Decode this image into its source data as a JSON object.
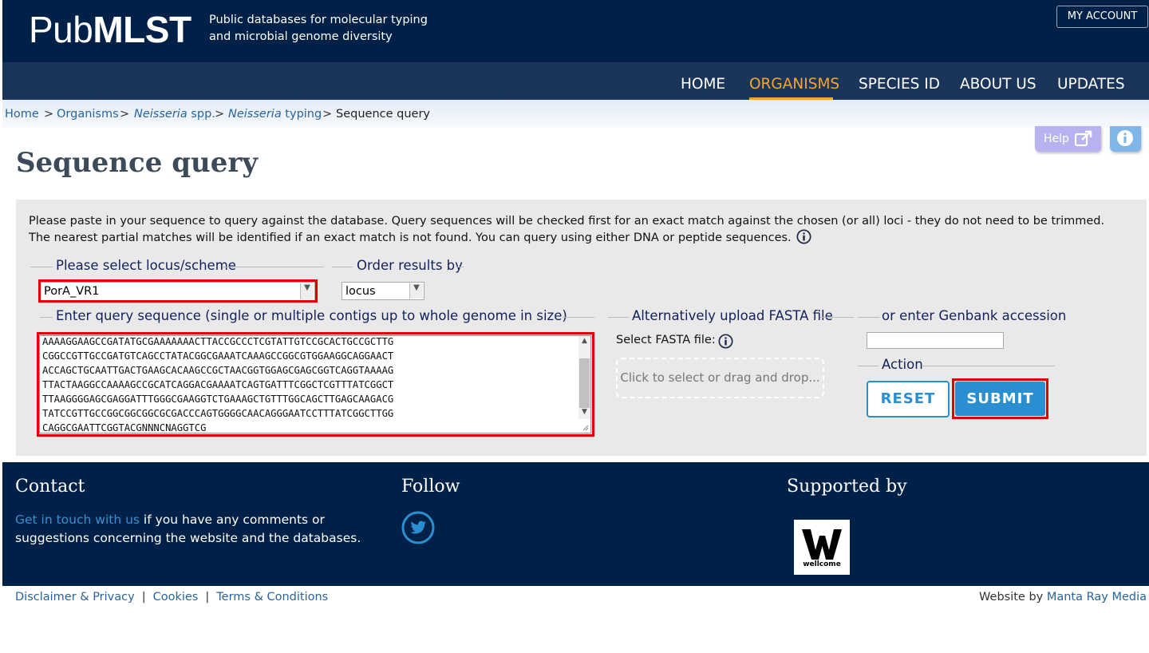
{
  "header": {
    "logo_light": "Pub",
    "logo_bold": "MLST",
    "tagline_line1": "Public databases for molecular typing",
    "tagline_line2": "and microbial genome diversity",
    "account_button": "MY ACCOUNT"
  },
  "nav": {
    "items": [
      {
        "label": "HOME"
      },
      {
        "label": "ORGANISMS"
      },
      {
        "label": "SPECIES ID"
      },
      {
        "label": "ABOUT US"
      },
      {
        "label": "UPDATES"
      }
    ],
    "active": "ORGANISMS"
  },
  "breadcrumb": {
    "home": "Home",
    "organisms": "Organisms",
    "species_italic": "Neisseria",
    "species_rest": " spp.",
    "typing_italic": "Neisseria",
    "typing_rest": " typing",
    "current": "Sequence query",
    "separator": ">"
  },
  "help": {
    "label": "Help",
    "icon": "external-link-icon"
  },
  "page_title": "Sequence query",
  "intro_text": "Please paste in your sequence to query against the database. Query sequences will be checked first for an exact match against the chosen (or all) loci - they do not need to be trimmed. The nearest partial matches will be identified if an exact match is not found. You can query using either DNA or peptide sequences.",
  "locus": {
    "legend": "Please select locus/scheme",
    "selected": "PorA_VR1"
  },
  "order": {
    "legend": "Order results by",
    "selected": "locus"
  },
  "query": {
    "legend": "Enter query sequence (single or multiple contigs up to whole genome in size)",
    "lines": [
      "AAAAGGAAGCCGATATGCGAAAAAAACTTACCGCCCTCGTATTGTCCGCACTGCCGCTTG",
      "CGGCCGTTGCCGATGTCAGCCTATACGGCGAAATCAAAGCCGGCGTGGAAGGCAGGAACT",
      "ACCAGCTGCAATTGACTGAAGCACAAGCCGCTAACGGTGGAGCGAGCGGTCAGGTAAAAG",
      "TTACTAAGGCCAAAAGCCGCATCAGGACGAAAATCAGTGATTTCGGCTCGTTTATCGGCT",
      "TTAAGGGGAGCGAGGATTTGGGCGAAGGTCTGAAAGCTGTTTGGCAGCTTGAGCAAGACG",
      "TATCCGTTGCCGGCGGCGGCGCGACCCAGTGGGGCAACAGGGAATCCTTTATCGGCTTGG",
      "CAGGCGAATTCGGTACGNNNCNAGGTCG"
    ]
  },
  "fasta": {
    "legend": "Alternatively upload FASTA file",
    "label": "Select FASTA file:",
    "dropzone": "Click to select or drag and drop..."
  },
  "genbank": {
    "legend": "or enter Genbank accession",
    "value": ""
  },
  "action": {
    "legend": "Action",
    "reset": "RESET",
    "submit": "SUBMIT"
  },
  "footer": {
    "contact_heading": "Contact",
    "contact_link": "Get in touch with us",
    "contact_text": " if you have any comments or suggestions concerning the website and the databases.",
    "follow_heading": "Follow",
    "supported_heading": "Supported by",
    "sponsor_logo_text": "wellcome"
  },
  "bottom": {
    "disclaimer": "Disclaimer & Privacy",
    "cookies": "Cookies",
    "terms": "Terms & Conditions",
    "separator": "|",
    "credit_prefix": "Website by ",
    "credit_link": "Manta Ray Media"
  },
  "colors": {
    "header_bg": "#002147",
    "nav_bg": "#1b355a",
    "accent": "#f4a52a",
    "submit": "#2a8fd1",
    "highlight": "#e00000"
  }
}
